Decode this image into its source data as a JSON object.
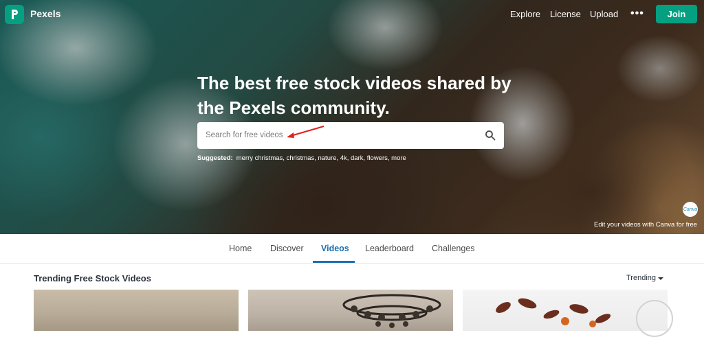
{
  "header": {
    "brand": "Pexels",
    "nav": [
      "Explore",
      "License",
      "Upload"
    ],
    "more_label": "•••",
    "join_label": "Join"
  },
  "hero": {
    "headline_line1": "The best free stock videos shared by",
    "headline_line2": "the Pexels community.",
    "search_placeholder": "Search for free videos",
    "suggested_label": "Suggested:",
    "suggested_terms": "merry christmas, christmas, nature, 4k, dark, flowers, more",
    "canva_badge": "Canva",
    "canva_text": "Edit your videos with Canva for free"
  },
  "tabs": [
    "Home",
    "Discover",
    "Videos",
    "Leaderboard",
    "Challenges"
  ],
  "active_tab": "Videos",
  "section": {
    "title": "Trending Free Stock Videos",
    "sort_label": "Trending"
  },
  "colors": {
    "accent": "#05a081",
    "active_tab": "#1a6fb0"
  },
  "icons": {
    "logo": "pexels-logo-icon",
    "search": "search-icon",
    "sort": "caret-down-icon"
  }
}
